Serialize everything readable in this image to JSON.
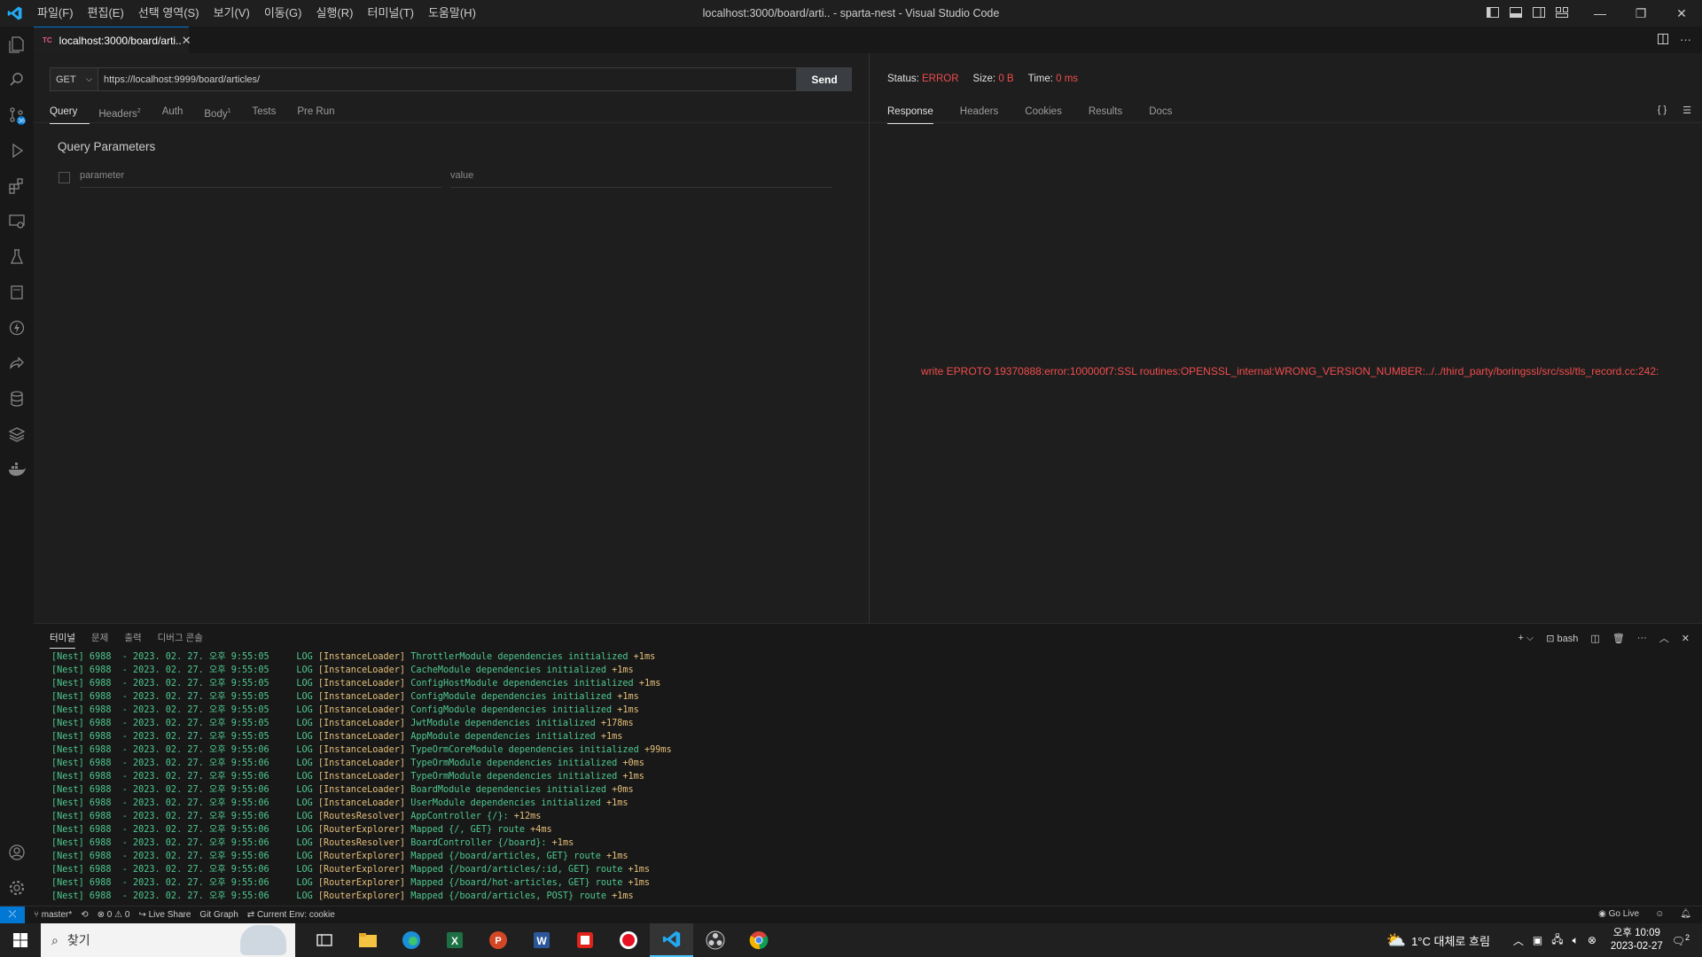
{
  "titlebar": {
    "title": "localhost:3000/board/arti.. - sparta-nest - Visual Studio Code",
    "menus": [
      "파일(F)",
      "편집(E)",
      "선택 영역(S)",
      "보기(V)",
      "이동(G)",
      "실행(R)",
      "터미널(T)",
      "도움말(H)"
    ]
  },
  "activitybar": {
    "items": [
      "explorer-icon",
      "search-icon",
      "source-control-icon",
      "run-debug-icon",
      "extensions-icon",
      "remote-explorer-icon",
      "testing-icon",
      "notebook-icon",
      "thunder-client-icon",
      "live-share-icon",
      "database-icon",
      "layers-icon",
      "docker-icon"
    ],
    "scm_badge": "36",
    "bottom": [
      "account-icon",
      "settings-gear-icon"
    ]
  },
  "tab": {
    "label": "localhost:3000/board/arti..",
    "prefix": "TC"
  },
  "request": {
    "method": "GET",
    "url": "https://localhost:9999/board/articles/",
    "send_label": "Send",
    "tabs": [
      {
        "label": "Query",
        "badge": ""
      },
      {
        "label": "Headers",
        "badge": "2"
      },
      {
        "label": "Auth",
        "badge": ""
      },
      {
        "label": "Body",
        "badge": "1"
      },
      {
        "label": "Tests",
        "badge": ""
      },
      {
        "label": "Pre Run",
        "badge": ""
      }
    ],
    "query_title": "Query Parameters",
    "param_placeholder": "parameter",
    "value_placeholder": "value"
  },
  "response": {
    "status_label": "Status:",
    "status_value": "ERROR",
    "size_label": "Size:",
    "size_value": "0 B",
    "time_label": "Time:",
    "time_value": "0 ms",
    "tabs": [
      "Response",
      "Headers",
      "Cookies",
      "Results",
      "Docs"
    ],
    "error_message": "write EPROTO 19370888:error:100000f7:SSL routines:OPENSSL_internal:WRONG_VERSION_NUMBER:../../third_party/boringssl/src/ssl/tls_record.cc:242:"
  },
  "panel": {
    "tabs": [
      "터미널",
      "문제",
      "출력",
      "디버그 콘솔"
    ],
    "shell": "bash",
    "lines": [
      {
        "prefix": "[Nest] 6988  - 2023. 02. 27. 오후 9:55:05",
        "level": "LOG",
        "ctx": "[InstanceLoader]",
        "msg": "ThrottlerModule dependencies initialized",
        "t": "+1ms"
      },
      {
        "prefix": "[Nest] 6988  - 2023. 02. 27. 오후 9:55:05",
        "level": "LOG",
        "ctx": "[InstanceLoader]",
        "msg": "CacheModule dependencies initialized",
        "t": "+1ms"
      },
      {
        "prefix": "[Nest] 6988  - 2023. 02. 27. 오후 9:55:05",
        "level": "LOG",
        "ctx": "[InstanceLoader]",
        "msg": "ConfigHostModule dependencies initialized",
        "t": "+1ms"
      },
      {
        "prefix": "[Nest] 6988  - 2023. 02. 27. 오후 9:55:05",
        "level": "LOG",
        "ctx": "[InstanceLoader]",
        "msg": "ConfigModule dependencies initialized",
        "t": "+1ms"
      },
      {
        "prefix": "[Nest] 6988  - 2023. 02. 27. 오후 9:55:05",
        "level": "LOG",
        "ctx": "[InstanceLoader]",
        "msg": "ConfigModule dependencies initialized",
        "t": "+1ms"
      },
      {
        "prefix": "[Nest] 6988  - 2023. 02. 27. 오후 9:55:05",
        "level": "LOG",
        "ctx": "[InstanceLoader]",
        "msg": "JwtModule dependencies initialized",
        "t": "+178ms"
      },
      {
        "prefix": "[Nest] 6988  - 2023. 02. 27. 오후 9:55:05",
        "level": "LOG",
        "ctx": "[InstanceLoader]",
        "msg": "AppModule dependencies initialized",
        "t": "+1ms"
      },
      {
        "prefix": "[Nest] 6988  - 2023. 02. 27. 오후 9:55:06",
        "level": "LOG",
        "ctx": "[InstanceLoader]",
        "msg": "TypeOrmCoreModule dependencies initialized",
        "t": "+99ms"
      },
      {
        "prefix": "[Nest] 6988  - 2023. 02. 27. 오후 9:55:06",
        "level": "LOG",
        "ctx": "[InstanceLoader]",
        "msg": "TypeOrmModule dependencies initialized",
        "t": "+0ms"
      },
      {
        "prefix": "[Nest] 6988  - 2023. 02. 27. 오후 9:55:06",
        "level": "LOG",
        "ctx": "[InstanceLoader]",
        "msg": "TypeOrmModule dependencies initialized",
        "t": "+1ms"
      },
      {
        "prefix": "[Nest] 6988  - 2023. 02. 27. 오후 9:55:06",
        "level": "LOG",
        "ctx": "[InstanceLoader]",
        "msg": "BoardModule dependencies initialized",
        "t": "+0ms"
      },
      {
        "prefix": "[Nest] 6988  - 2023. 02. 27. 오후 9:55:06",
        "level": "LOG",
        "ctx": "[InstanceLoader]",
        "msg": "UserModule dependencies initialized",
        "t": "+1ms"
      },
      {
        "prefix": "[Nest] 6988  - 2023. 02. 27. 오후 9:55:06",
        "level": "LOG",
        "ctx": "[RoutesResolver]",
        "msg": "AppController {/}:",
        "t": "+12ms"
      },
      {
        "prefix": "[Nest] 6988  - 2023. 02. 27. 오후 9:55:06",
        "level": "LOG",
        "ctx": "[RouterExplorer]",
        "msg": "Mapped {/, GET} route",
        "t": "+4ms"
      },
      {
        "prefix": "[Nest] 6988  - 2023. 02. 27. 오후 9:55:06",
        "level": "LOG",
        "ctx": "[RoutesResolver]",
        "msg": "BoardController {/board}:",
        "t": "+1ms"
      },
      {
        "prefix": "[Nest] 6988  - 2023. 02. 27. 오후 9:55:06",
        "level": "LOG",
        "ctx": "[RouterExplorer]",
        "msg": "Mapped {/board/articles, GET} route",
        "t": "+1ms"
      },
      {
        "prefix": "[Nest] 6988  - 2023. 02. 27. 오후 9:55:06",
        "level": "LOG",
        "ctx": "[RouterExplorer]",
        "msg": "Mapped {/board/articles/:id, GET} route",
        "t": "+1ms"
      },
      {
        "prefix": "[Nest] 6988  - 2023. 02. 27. 오후 9:55:06",
        "level": "LOG",
        "ctx": "[RouterExplorer]",
        "msg": "Mapped {/board/hot-articles, GET} route",
        "t": "+1ms"
      },
      {
        "prefix": "[Nest] 6988  - 2023. 02. 27. 오후 9:55:06",
        "level": "LOG",
        "ctx": "[RouterExplorer]",
        "msg": "Mapped {/board/articles, POST} route",
        "t": "+1ms"
      }
    ]
  },
  "statusbar": {
    "branch": "master*",
    "problems": "⊗ 0 ⚠ 0",
    "live_share": "Live Share",
    "git_graph": "Git Graph",
    "env": "Current Env: cookie",
    "go_live": "Go Live"
  },
  "taskbar": {
    "search_placeholder": "찾기",
    "apps": [
      "task-view-icon",
      "file-explorer-icon",
      "edge-icon",
      "excel-icon",
      "powerpoint-icon",
      "word-icon",
      "pdf-reader-icon",
      "recorder-icon",
      "vscode-icon",
      "obs-icon",
      "chrome-icon"
    ],
    "weather": "1°C 대체로 흐림",
    "time": "오후 10:09",
    "date": "2023-02-27",
    "notifications": "2"
  },
  "colors": {
    "accent": "#0078d4",
    "error": "#f14c4c",
    "log_green": "#4ec98f",
    "log_yellow": "#e5c07b"
  }
}
